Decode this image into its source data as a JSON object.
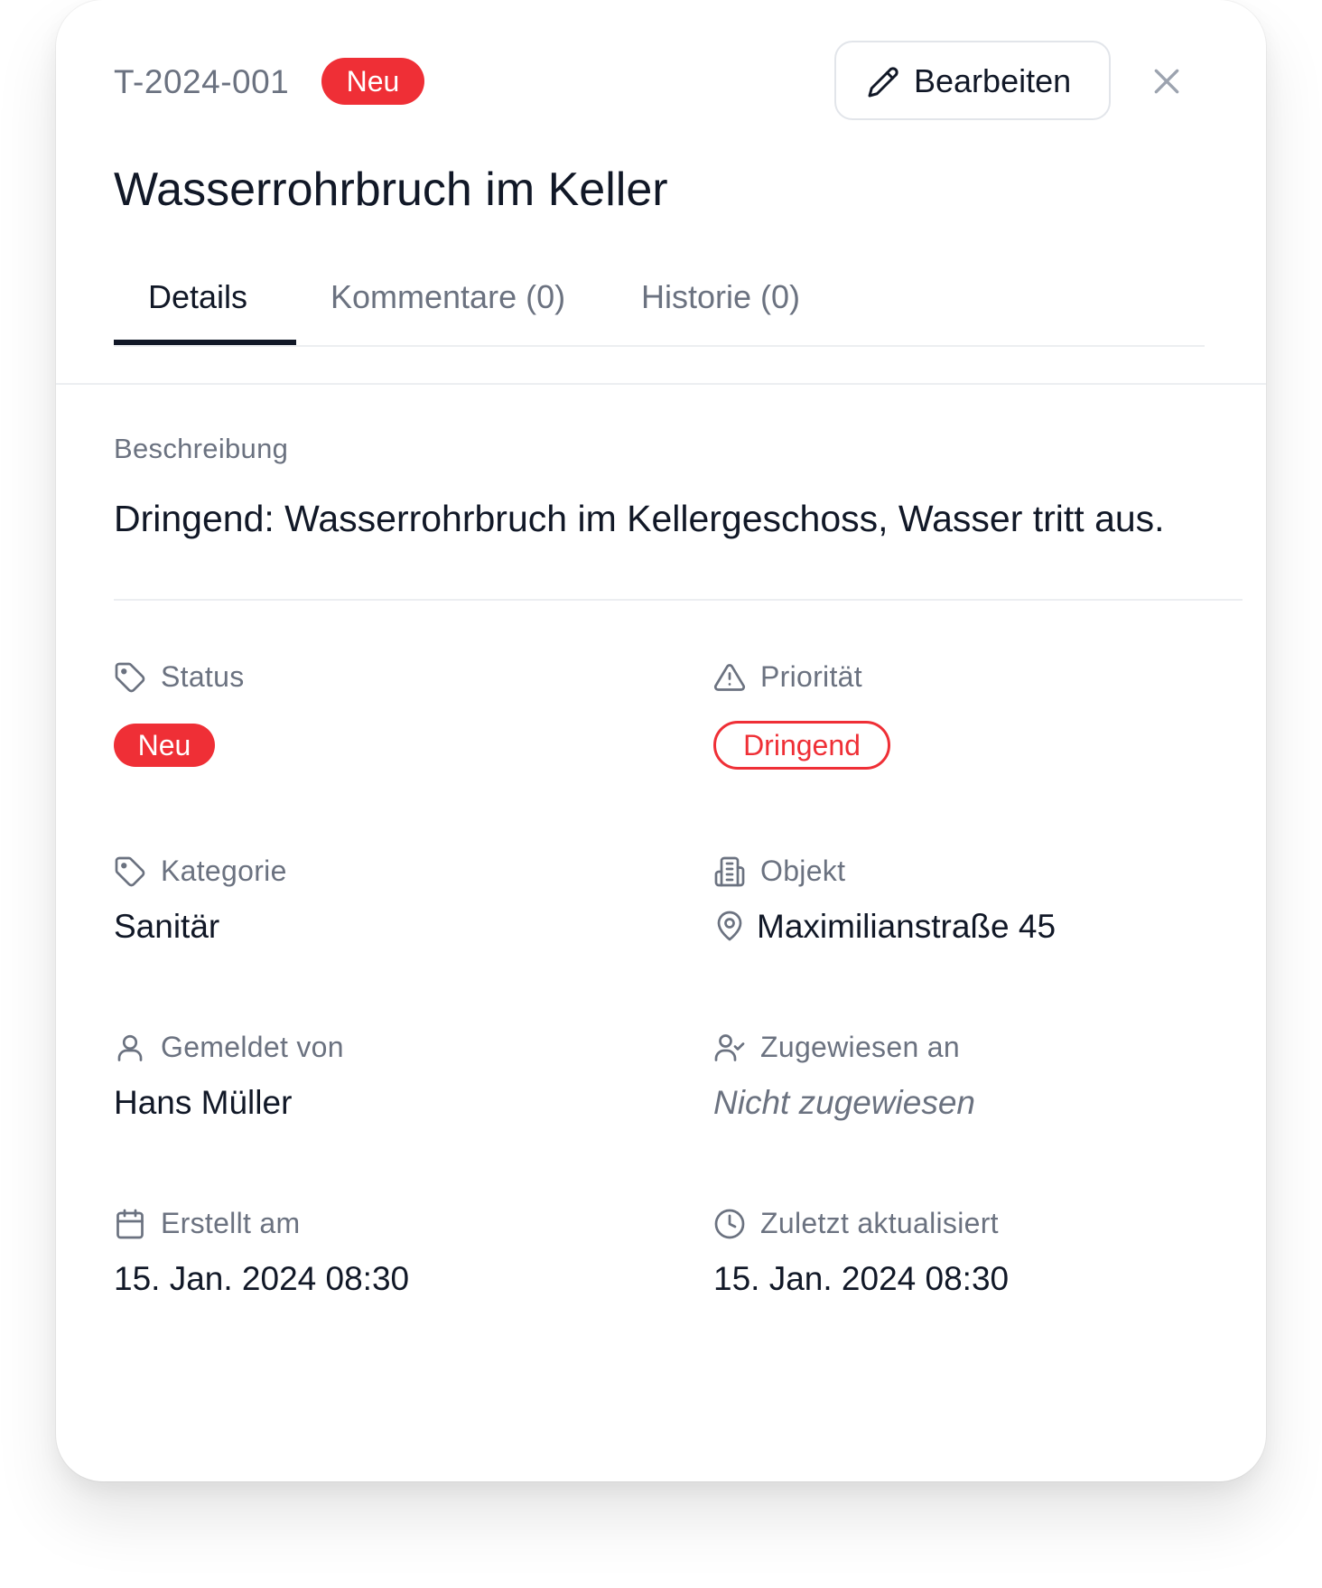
{
  "header": {
    "ticket_id": "T-2024-001",
    "status_badge": "Neu",
    "edit_label": "Bearbeiten",
    "title": "Wasserrohrbruch im Keller"
  },
  "tabs": [
    {
      "label": "Details",
      "active": true
    },
    {
      "label": "Kommentare (0)",
      "active": false
    },
    {
      "label": "Historie (0)",
      "active": false
    }
  ],
  "description": {
    "label": "Beschreibung",
    "text": "Dringend: Wasserrohrbruch im Kellergeschoss, Wasser tritt aus."
  },
  "fields": {
    "status": {
      "label": "Status",
      "value": "Neu",
      "icon": "tag-icon"
    },
    "priority": {
      "label": "Priorität",
      "value": "Dringend",
      "icon": "alert-triangle-icon"
    },
    "category": {
      "label": "Kategorie",
      "value": "Sanitär",
      "icon": "tag-icon"
    },
    "object": {
      "label": "Objekt",
      "value": "Maximilianstraße 45",
      "icon": "building-icon",
      "value_icon": "map-pin-icon"
    },
    "reported_by": {
      "label": "Gemeldet von",
      "value": "Hans Müller",
      "icon": "user-icon"
    },
    "assigned_to": {
      "label": "Zugewiesen an",
      "value": "Nicht zugewiesen",
      "icon": "user-check-icon"
    },
    "created_at": {
      "label": "Erstellt am",
      "value": "15. Jan. 2024 08:30",
      "icon": "calendar-icon"
    },
    "updated_at": {
      "label": "Zuletzt aktualisiert",
      "value": "15. Jan. 2024 08:30",
      "icon": "clock-icon"
    }
  },
  "colors": {
    "accent_red": "#ef2f36",
    "text_primary": "#111827",
    "text_muted": "#6b7280",
    "border": "#eceef1"
  }
}
